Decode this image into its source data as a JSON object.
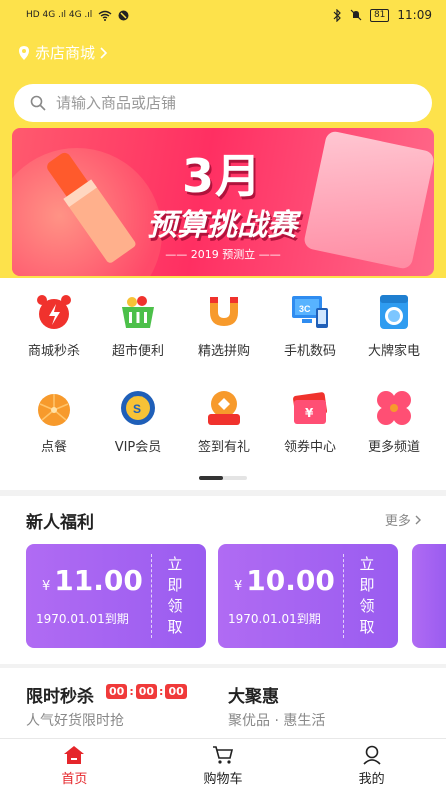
{
  "status_bar": {
    "time": "11:09",
    "battery": "81",
    "signal_left": "HD 4G .ıl 4G .ıl",
    "accent": "#fde24b"
  },
  "location": {
    "label": "赤店商城",
    "chevron": "chevron-right-icon"
  },
  "search": {
    "placeholder": "请输入商品或店铺"
  },
  "banner": {
    "title_line1": "3月",
    "title_line2": "预算挑战赛",
    "subtitle": "2019 预测立"
  },
  "categories": [
    {
      "label": "商城秒杀",
      "icon": "alarm-clock-icon"
    },
    {
      "label": "超市便利",
      "icon": "shopping-basket-icon"
    },
    {
      "label": "精选拼购",
      "icon": "smile-magnet-icon"
    },
    {
      "label": "手机数码",
      "icon": "computer-phone-icon"
    },
    {
      "label": "大牌家电",
      "icon": "washing-machine-icon"
    },
    {
      "label": "点餐",
      "icon": "orange-icon"
    },
    {
      "label": "VIP会员",
      "icon": "vip-coin-icon"
    },
    {
      "label": "签到有礼",
      "icon": "gift-box-icon"
    },
    {
      "label": "领券中心",
      "icon": "ticket-icon"
    },
    {
      "label": "更多频道",
      "icon": "clover-icon"
    }
  ],
  "new_user": {
    "title": "新人福利",
    "more": "更多",
    "coupons": [
      {
        "currency": "¥",
        "amount": "11.00",
        "expiry": "1970.01.01到期",
        "action": [
          "立",
          "即",
          "领",
          "取"
        ]
      },
      {
        "currency": "¥",
        "amount": "10.00",
        "expiry": "1970.01.01到期",
        "action": [
          "立",
          "即",
          "领",
          "取"
        ]
      }
    ],
    "coupon_color": "#a463f2"
  },
  "flash_sale": {
    "title": "限时秒杀",
    "hh": "00",
    "mm": "00",
    "ss": "00",
    "subtitle": "人气好货限时抢",
    "timer_color": "#f03a3a"
  },
  "big_deal": {
    "title": "大聚惠",
    "subtitle": "聚优品 · 惠生活"
  },
  "tabbar": {
    "items": [
      {
        "label": "首页",
        "icon": "home-icon",
        "active": true
      },
      {
        "label": "购物车",
        "icon": "cart-icon",
        "active": false
      },
      {
        "label": "我的",
        "icon": "user-icon",
        "active": false
      }
    ],
    "active_color": "#e5262b"
  }
}
